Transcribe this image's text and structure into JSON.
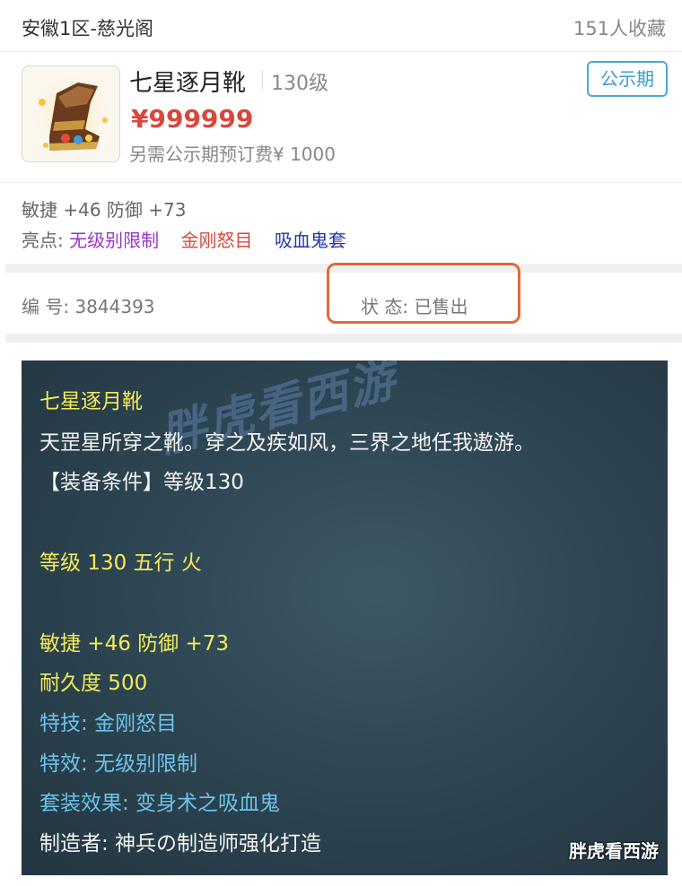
{
  "header": {
    "server": "安徽1区-慈光阁",
    "favorites": "151人收藏"
  },
  "item": {
    "name": "七星逐月靴",
    "level": "130级",
    "price": "¥999999",
    "fee_note": "另需公示期预订费¥ 1000",
    "status_button": "公示期",
    "thumbnail_icon": "boots-icon"
  },
  "attributes": {
    "stats": "敏捷 +46 防御 +73",
    "highlight_label": "亮点:",
    "tags": [
      "无级别限制",
      "金刚怒目",
      "吸血鬼套"
    ]
  },
  "meta": {
    "id_text": "编 号:  3844393",
    "state_text": "状 态:  已售出"
  },
  "description": {
    "lines": [
      "七星逐月靴",
      "天罡星所穿之靴。穿之及疾如风，三界之地任我遨游。",
      "【装备条件】等级130",
      "等级 130 五行 火",
      "敏捷 +46 防御 +73",
      "耐久度 500",
      "特技:  金刚怒目",
      "特效:  无级别限制",
      "套装效果:  变身术之吸血鬼",
      "制造者:  神兵の制造师强化打造"
    ],
    "watermark": "胖虎看西游",
    "corner_mark": "胖虎看西游"
  }
}
